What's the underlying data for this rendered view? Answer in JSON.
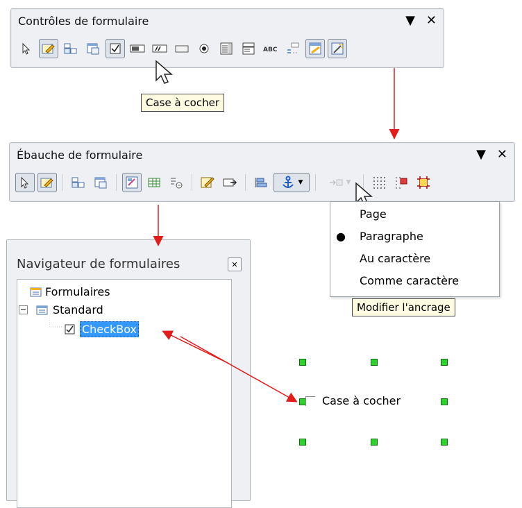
{
  "form_controls": {
    "title": "Contrôles de formulaire",
    "menu_glyph": "▼",
    "close_glyph": "✕",
    "tooltip": "Case à cocher"
  },
  "form_design": {
    "title": "Ébauche de formulaire",
    "menu_glyph": "▼",
    "close_glyph": "✕",
    "anchor_menu": {
      "items": [
        {
          "label": "Page",
          "selected": false
        },
        {
          "label": "Paragraphe",
          "selected": true
        },
        {
          "label": "Au caractère",
          "selected": false
        },
        {
          "label": "Comme caractère",
          "selected": false
        }
      ]
    },
    "tooltip": "Modifier l'ancrage"
  },
  "navigator": {
    "title": "Navigateur de formulaires",
    "tree": {
      "root": "Formulaires",
      "form": "Standard",
      "control": "CheckBox"
    }
  },
  "canvas": {
    "checkbox_label": "Case à cocher"
  },
  "colors": {
    "arrow": "#e31b1b",
    "selection": "#3399ff",
    "handle": "#2fd12f",
    "tooltip_bg": "#fffbe0"
  }
}
